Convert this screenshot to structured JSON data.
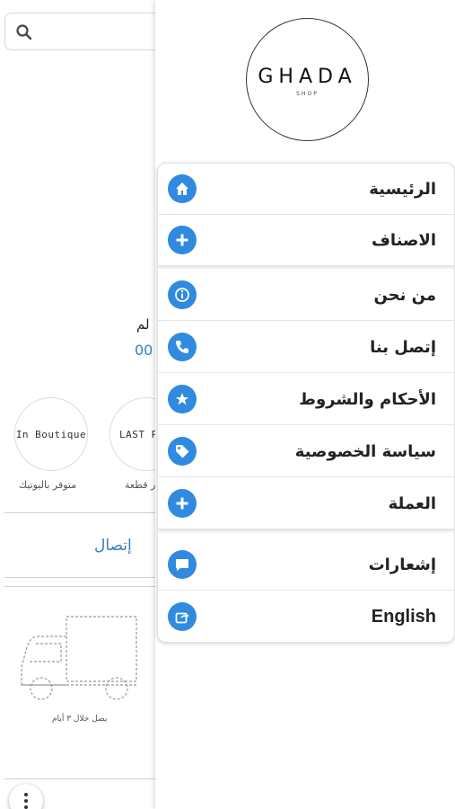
{
  "background": {
    "partial_text_1": "لم",
    "partial_text_2": "00",
    "badges": [
      {
        "circle_text": "In Boutique",
        "caption": "متوفر بالبوتيك"
      },
      {
        "circle_text": "LAST PI",
        "caption": "ر قطعة"
      }
    ],
    "contact_link": "إتصال",
    "delivery_caption": "يصل خلال ٣ أيام"
  },
  "drawer": {
    "logo": {
      "brand": "GHADA",
      "sub": "SHOP"
    },
    "menu": [
      {
        "label": "الرئيسية",
        "icon": "home-icon"
      },
      {
        "label": "الاصناف",
        "icon": "plus-circle-icon"
      },
      {
        "label": "من نحن",
        "icon": "info-icon"
      },
      {
        "label": "إتصل بنا",
        "icon": "phone-icon"
      },
      {
        "label": "الأحكام والشروط",
        "icon": "star-icon"
      },
      {
        "label": "سياسة الخصوصية",
        "icon": "tag-icon"
      },
      {
        "label": "العملة",
        "icon": "plus-circle-icon"
      },
      {
        "label": "إشعارات",
        "icon": "chat-bubble-icon"
      },
      {
        "label": "English",
        "icon": "share-icon"
      }
    ]
  },
  "colors": {
    "accent": "#2f8ae0",
    "link": "#3b7dc4"
  }
}
